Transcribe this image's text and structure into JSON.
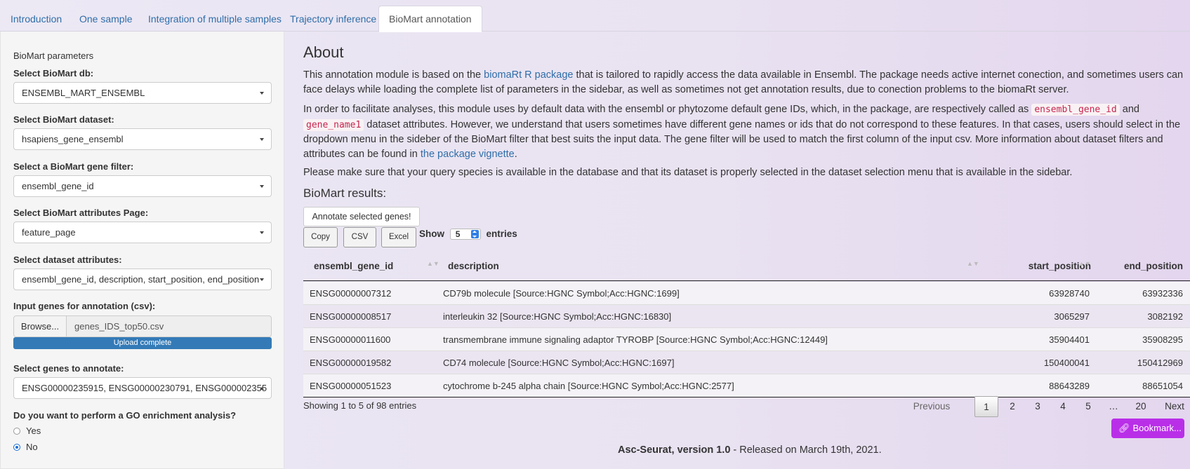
{
  "tabs": [
    {
      "label": "Introduction"
    },
    {
      "label": "One sample"
    },
    {
      "label": "Integration of multiple samples"
    },
    {
      "label": "Trajectory inference"
    },
    {
      "label": "BioMart annotation",
      "active": true
    }
  ],
  "sidebar": {
    "title": "BioMart parameters",
    "db_label": "Select BioMart db:",
    "db_value": "ENSEMBL_MART_ENSEMBL",
    "dataset_label": "Select BioMart dataset:",
    "dataset_value": "hsapiens_gene_ensembl",
    "filter_label": "Select a BioMart gene filter:",
    "filter_value": "ensembl_gene_id",
    "page_label": "Select BioMart attributes Page:",
    "page_value": "feature_page",
    "attributes_label": "Select dataset attributes:",
    "attributes_value": "ensembl_gene_id, description, start_position, end_position",
    "input_label": "Input genes for annotation (csv):",
    "browse_label": "Browse...",
    "file_name": "genes_IDS_top50.csv",
    "upload_status": "Upload complete",
    "genes_label": "Select genes to annotate:",
    "genes_value": "ENSG00000235915, ENSG00000230791, ENSG000002355",
    "go_label": "Do you want to perform a GO enrichment analysis?",
    "go_options": [
      {
        "label": "Yes",
        "selected": false
      },
      {
        "label": "No",
        "selected": true
      }
    ]
  },
  "main": {
    "heading": "About",
    "p1_a": "This annotation module is based on the ",
    "p1_link": "biomaRt R package",
    "p1_b": " that is tailored to rapidly access the data available in Ensembl. The package needs active internet conection, and sometimes users can face delays while loading the complete list of parameters in the sidebar, as well as sometimes not get annotation results, due to conection problems to the biomaRt server.",
    "p2_a": "In order to facilitate analyses, this module uses by default data with the ensembl or phytozome default gene IDs, which, in the package, are respectively called as ",
    "p2_code1": "ensembl_gene_id",
    "p2_b": " and ",
    "p2_code2": "gene_name1",
    "p2_c": " dataset attributes. However, we understand that users sometimes have different gene names or ids that do not correspond to these features. In that cases, users should select in the dropdown menu in the sideber of the BioMart filter that best suits the input data. The gene filter will be used to match the first column of the input csv. More information about dataset filters and attributes can be found in ",
    "p2_link": "the package vignette",
    "p2_d": ".",
    "p3": "Please make sure that your query species is available in the database and that its dataset is properly selected in the dataset selection menu that is available in the sidebar.",
    "results_heading": "BioMart results:",
    "annotate_button": "Annotate selected genes!",
    "buttons": {
      "copy": "Copy",
      "csv": "CSV",
      "excel": "Excel"
    },
    "show_label": "Show",
    "entries_value": "5",
    "entries_label": "entries"
  },
  "table": {
    "columns": [
      "ensembl_gene_id",
      "description",
      "start_position",
      "end_position"
    ],
    "rows": [
      [
        "ENSG00000007312",
        "CD79b molecule [Source:HGNC Symbol;Acc:HGNC:1699]",
        "63928740",
        "63932336"
      ],
      [
        "ENSG00000008517",
        "interleukin 32 [Source:HGNC Symbol;Acc:HGNC:16830]",
        "3065297",
        "3082192"
      ],
      [
        "ENSG00000011600",
        "transmembrane immune signaling adaptor TYROBP [Source:HGNC Symbol;Acc:HGNC:12449]",
        "35904401",
        "35908295"
      ],
      [
        "ENSG00000019582",
        "CD74 molecule [Source:HGNC Symbol;Acc:HGNC:1697]",
        "150400041",
        "150412969"
      ],
      [
        "ENSG00000051523",
        "cytochrome b-245 alpha chain [Source:HGNC Symbol;Acc:HGNC:2577]",
        "88643289",
        "88651054"
      ]
    ],
    "info": "Showing 1 to 5 of 98 entries",
    "pagination": {
      "previous": "Previous",
      "pages": [
        "1",
        "2",
        "3",
        "4",
        "5",
        "…",
        "20"
      ],
      "current": "1",
      "next": "Next"
    }
  },
  "bookmark_label": "Bookmark...",
  "footer": {
    "bold": "Asc-Seurat, version 1.0",
    "rest": " - Released on March 19th, 2021."
  },
  "colors": {
    "link": "#2f6ea8",
    "progress": "#337ab7",
    "bookmark": "#b92fe8",
    "code": "#c7254e"
  }
}
